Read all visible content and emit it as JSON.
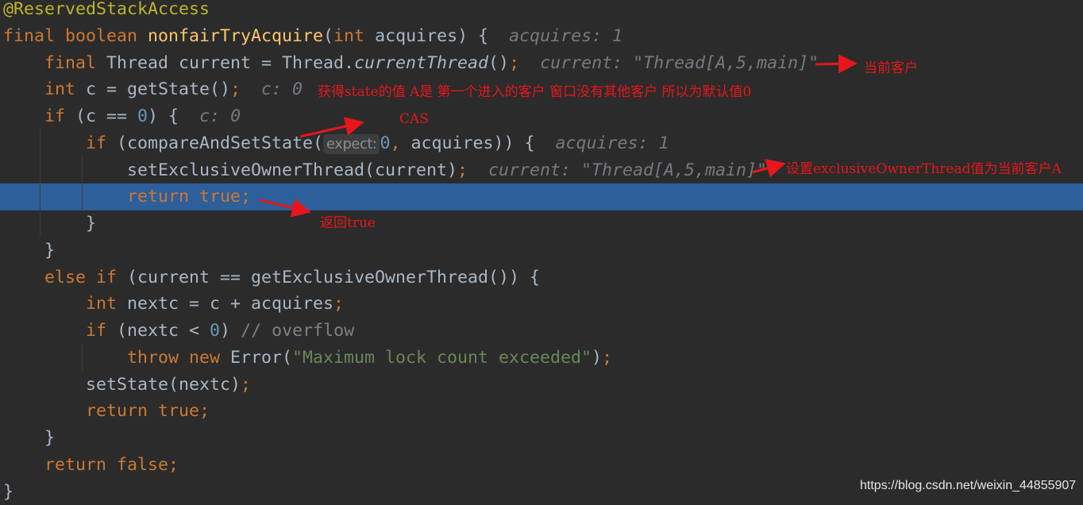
{
  "colors": {
    "background": "#2b2b2b",
    "keyword": "#cc7832",
    "text": "#a9b7c6",
    "method": "#ffc66d",
    "annotation": "#bbb529",
    "number": "#6897bb",
    "string": "#6a8759",
    "comment": "#808080",
    "hint": "#767a80",
    "highlight_line": "#2d5f9a",
    "note_red": "#e8161b"
  },
  "code": {
    "highlighted_line": 7,
    "lines": [
      {
        "tokens": [
          {
            "t": "@ReservedStackAccess",
            "c": "a"
          }
        ]
      },
      {
        "tokens": [
          {
            "t": "final boolean ",
            "c": "k"
          },
          {
            "t": "nonfairTryAcquire",
            "c": "m"
          },
          {
            "t": "(",
            "c": "p"
          },
          {
            "t": "int ",
            "c": "k"
          },
          {
            "t": "acquires) {  ",
            "c": "p"
          },
          {
            "t": "acquires: 1",
            "c": "h"
          }
        ]
      },
      {
        "tokens": [
          {
            "t": "    final ",
            "c": "k"
          },
          {
            "t": "Thread current = Thread.",
            "c": "p"
          },
          {
            "t": "currentThread",
            "c": "i"
          },
          {
            "t": "()",
            "c": "p"
          },
          {
            "t": ";  ",
            "c": "k"
          },
          {
            "t": "current: \"Thread[A,5,main]\"",
            "c": "h"
          }
        ]
      },
      {
        "tokens": [
          {
            "t": "    int ",
            "c": "k"
          },
          {
            "t": "c = getState()",
            "c": "p"
          },
          {
            "t": ";  ",
            "c": "k"
          },
          {
            "t": "c: 0",
            "c": "h"
          }
        ]
      },
      {
        "tokens": [
          {
            "t": "    if ",
            "c": "k"
          },
          {
            "t": "(c == ",
            "c": "p"
          },
          {
            "t": "0",
            "c": "n"
          },
          {
            "t": ") {  ",
            "c": "p"
          },
          {
            "t": "c: 0",
            "c": "h"
          }
        ]
      },
      {
        "tokens": [
          {
            "t": "        if ",
            "c": "k"
          },
          {
            "t": "(compareAndSetState(",
            "c": "p"
          },
          {
            "t": "expect:",
            "c": "x"
          },
          {
            "t": "0",
            "c": "n"
          },
          {
            "t": ", ",
            "c": "k"
          },
          {
            "t": "acquires)) {  ",
            "c": "p"
          },
          {
            "t": "acquires: 1",
            "c": "h"
          }
        ]
      },
      {
        "tokens": [
          {
            "t": "            setExclusiveOwnerThread(current)",
            "c": "p"
          },
          {
            "t": ";  ",
            "c": "k"
          },
          {
            "t": "current: \"Thread[A,5,main]\"",
            "c": "h"
          }
        ]
      },
      {
        "tokens": [
          {
            "t": "            return true;",
            "c": "k"
          }
        ]
      },
      {
        "tokens": [
          {
            "t": "        }",
            "c": "p"
          }
        ]
      },
      {
        "tokens": [
          {
            "t": "    }",
            "c": "p"
          }
        ]
      },
      {
        "tokens": [
          {
            "t": "    else if ",
            "c": "k"
          },
          {
            "t": "(current == getExclusiveOwnerThread()) {",
            "c": "p"
          }
        ]
      },
      {
        "tokens": [
          {
            "t": "        int ",
            "c": "k"
          },
          {
            "t": "nextc = c + acquires",
            "c": "p"
          },
          {
            "t": ";",
            "c": "k"
          }
        ]
      },
      {
        "tokens": [
          {
            "t": "        if ",
            "c": "k"
          },
          {
            "t": "(nextc < ",
            "c": "p"
          },
          {
            "t": "0",
            "c": "n"
          },
          {
            "t": ") ",
            "c": "p"
          },
          {
            "t": "// overflow",
            "c": "c"
          }
        ]
      },
      {
        "tokens": [
          {
            "t": "            throw new ",
            "c": "k"
          },
          {
            "t": "Error(",
            "c": "p"
          },
          {
            "t": "\"Maximum lock count exceeded\"",
            "c": "s"
          },
          {
            "t": ")",
            "c": "p"
          },
          {
            "t": ";",
            "c": "k"
          }
        ]
      },
      {
        "tokens": [
          {
            "t": "        setState(nextc)",
            "c": "p"
          },
          {
            "t": ";",
            "c": "k"
          }
        ]
      },
      {
        "tokens": [
          {
            "t": "        return true;",
            "c": "k"
          }
        ]
      },
      {
        "tokens": [
          {
            "t": "    }",
            "c": "p"
          }
        ]
      },
      {
        "tokens": [
          {
            "t": "    return false;",
            "c": "k"
          }
        ]
      },
      {
        "tokens": [
          {
            "t": "}",
            "c": "p"
          }
        ]
      }
    ]
  },
  "annotations": {
    "current_client": "当前客户",
    "get_state": "获得state的值  A是 第一个进入的客户 窗口没有其他客户 所以为默认值0",
    "cas": "CAS",
    "set_owner": "设置exclusiveOwnerThread值为当前客户A",
    "return_true": "返回true"
  },
  "watermark": "https://blog.csdn.net/weixin_44855907"
}
